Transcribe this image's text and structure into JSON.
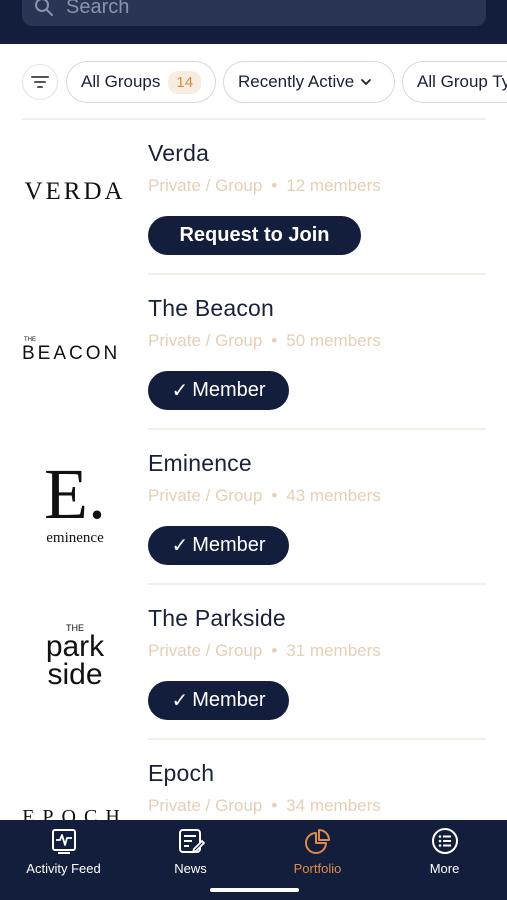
{
  "search": {
    "placeholder": "Search"
  },
  "filters": {
    "chip_all_groups": {
      "label": "All Groups",
      "count": "14"
    },
    "chip_sort": {
      "label": "Recently Active"
    },
    "chip_type": {
      "label": "All Group Types"
    }
  },
  "groups": [
    {
      "name": "Verda",
      "privacy": "Private / Group",
      "members": "12 members",
      "action": "Request to Join",
      "logo_text": "VERDA"
    },
    {
      "name": "The Beacon",
      "privacy": "Private / Group",
      "members": "50 members",
      "action": "Member",
      "logo_small": "THE",
      "logo_text": "BEACON"
    },
    {
      "name": "Eminence",
      "privacy": "Private / Group",
      "members": "43 members",
      "action": "Member",
      "logo_mark": "E.",
      "logo_text": "eminence"
    },
    {
      "name": "The Parkside",
      "privacy": "Private / Group",
      "members": "31 members",
      "action": "Member",
      "logo_small": "THE",
      "logo_line1": "park",
      "logo_line2": "side"
    },
    {
      "name": "Epoch",
      "privacy": "Private / Group",
      "members": "34 members",
      "logo_text": "EPOCH"
    }
  ],
  "separator": "•",
  "check": "✓",
  "tabs": [
    {
      "label": "Activity Feed",
      "icon": "activity-feed-icon"
    },
    {
      "label": "News",
      "icon": "news-icon"
    },
    {
      "label": "Portfolio",
      "icon": "portfolio-icon",
      "active": true
    },
    {
      "label": "More",
      "icon": "more-icon"
    }
  ],
  "colors": {
    "navy": "#131d3c",
    "accent": "#e08a45",
    "meta": "#e5cfb5",
    "badge_bg": "#f7ece0"
  }
}
